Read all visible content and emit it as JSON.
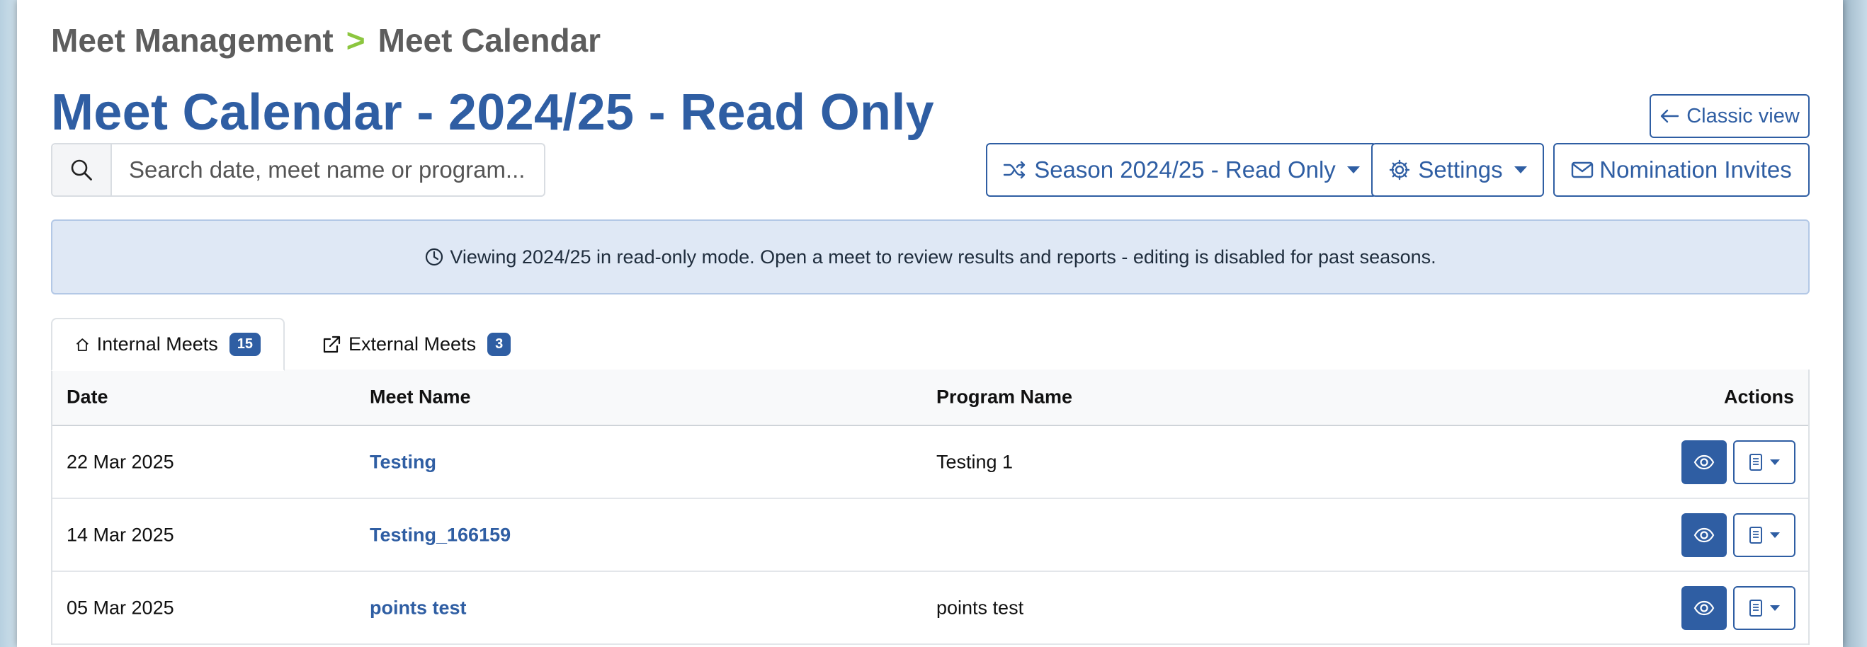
{
  "breadcrumb": {
    "parent": "Meet Management",
    "separator": ">",
    "current": "Meet Calendar"
  },
  "page_title": "Meet Calendar - 2024/25 - Read Only",
  "toolbar": {
    "classic_view_label": "Classic view",
    "season_label": "Season 2024/25 - Read Only",
    "settings_label": "Settings",
    "nomination_invites_label": "Nomination Invites"
  },
  "search": {
    "placeholder": "Search date, meet name or program...",
    "value": ""
  },
  "alert": {
    "text": "Viewing 2024/25 in read-only mode. Open a meet to review results and reports - editing is disabled for past seasons."
  },
  "tabs": [
    {
      "label": "Internal Meets",
      "count": "15",
      "active": true
    },
    {
      "label": "External Meets",
      "count": "3",
      "active": false
    }
  ],
  "table": {
    "headers": {
      "date": "Date",
      "meet_name": "Meet Name",
      "program_name": "Program Name",
      "actions": "Actions"
    },
    "rows": [
      {
        "date": "22 Mar 2025",
        "meet_name": "Testing",
        "program_name": "Testing 1"
      },
      {
        "date": "14 Mar 2025",
        "meet_name": "Testing_166159",
        "program_name": ""
      },
      {
        "date": "05 Mar 2025",
        "meet_name": "points test",
        "program_name": "points test"
      }
    ]
  },
  "colors": {
    "primary": "#2f5ea3",
    "breadcrumb_separator": "#8cc63f",
    "alert_bg": "#dfe8f5"
  },
  "icons": {
    "search": "search-icon",
    "arrow_left": "arrow-left-icon",
    "shuffle": "shuffle-icon",
    "gear": "gear-icon",
    "envelope": "envelope-icon",
    "clock": "clock-icon",
    "home": "home-icon",
    "external_link": "external-link-icon",
    "eye": "eye-icon",
    "document": "document-icon"
  }
}
